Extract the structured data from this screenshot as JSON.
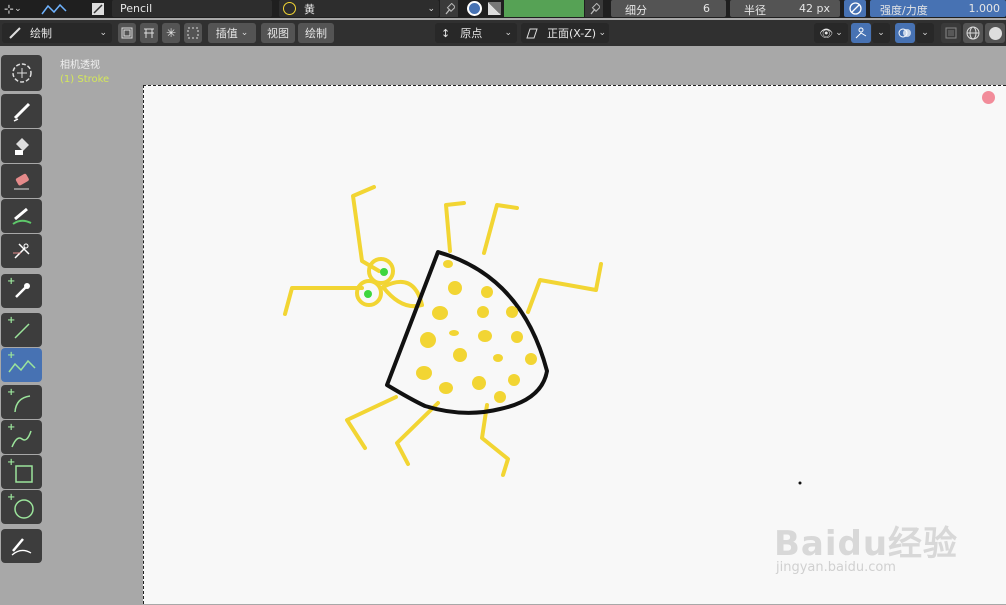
{
  "top_bar": {
    "brush_name": "Pencil",
    "material_name": "黄",
    "subdivision_label": "细分",
    "subdivision_value": "6",
    "radius_label": "半径",
    "radius_value": "42 px",
    "strength_label": "强度/力度",
    "strength_value": "1.000"
  },
  "header2": {
    "mode_label": "绘制",
    "interpolate_label": "插值",
    "view_label": "视图",
    "draw_label": "绘制",
    "origin_label": "原点",
    "plane_label": "正面(X-Z)"
  },
  "viewport": {
    "camera_label": "相机透视",
    "object_label": "(1) Stroke"
  },
  "watermark": {
    "brand": "Baidu经验",
    "url": "jingyan.baidu.com"
  },
  "colors": {
    "accent": "#4772b3",
    "stroke_yellow": "#f2d533",
    "eye_green": "#3ed63e"
  }
}
